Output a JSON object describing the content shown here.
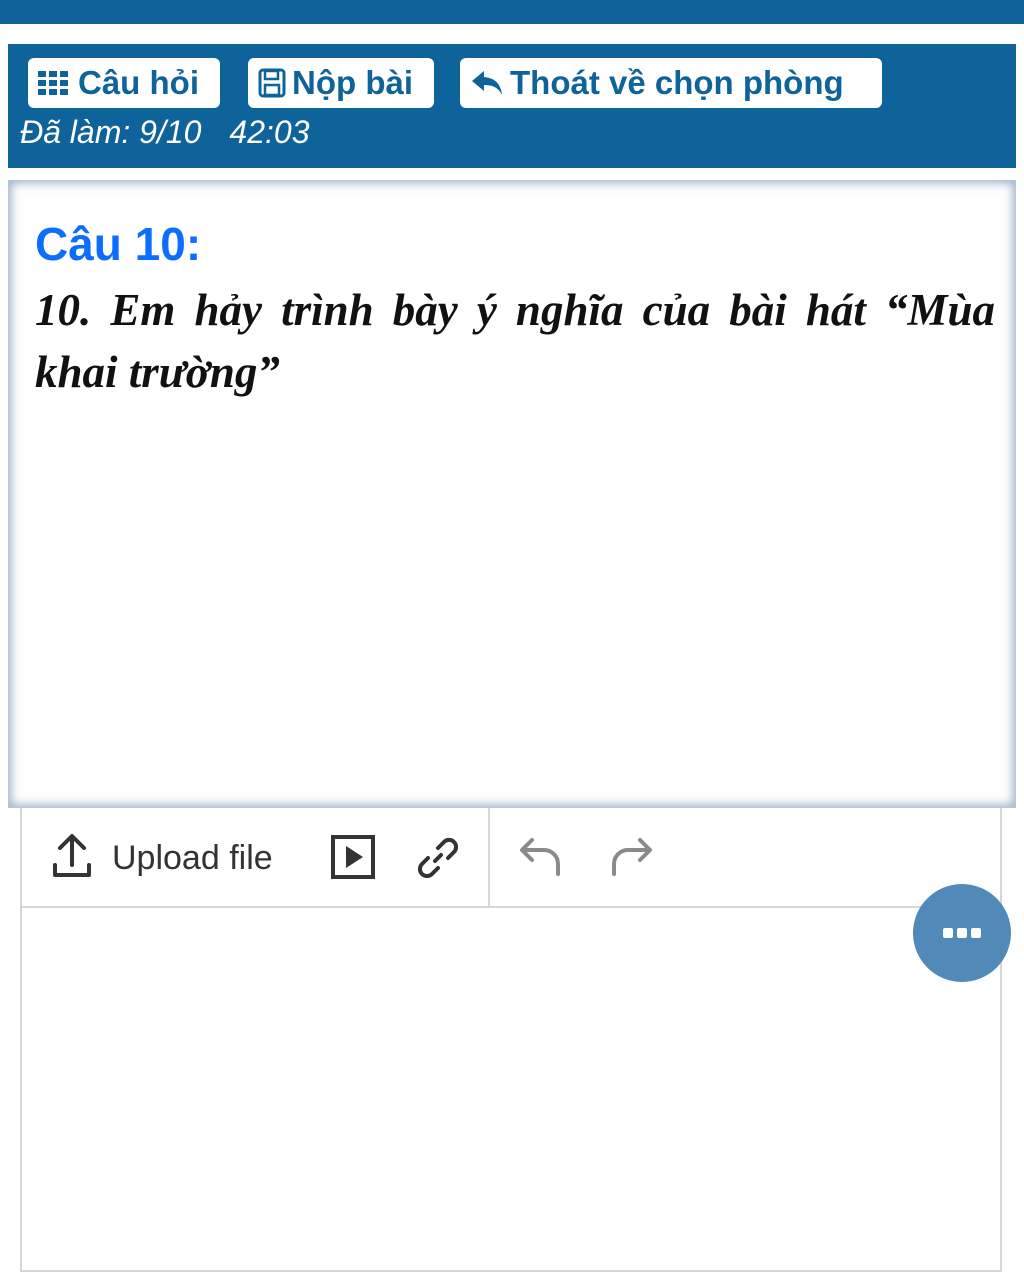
{
  "header": {
    "questions_label": "Câu hỏi",
    "submit_label": "Nộp bài",
    "exit_label": "Thoát về chọn phòng",
    "progress": "Đã làm: 9/10",
    "timer": "42:03"
  },
  "question": {
    "title": "Câu 10:",
    "text": "10. Em hảy trình bày ý nghĩa của bài hát “Mùa khai trường”"
  },
  "editor": {
    "upload_label": "Upload file",
    "icons": [
      "upload-icon",
      "media-icon",
      "link-icon",
      "undo-icon",
      "redo-icon"
    ],
    "content": ""
  },
  "fab": {
    "icon": "more-icon"
  },
  "colors": {
    "header_bg": "#0e639b",
    "title_blue": "#0d6efd",
    "fab_bg": "#5189b8"
  }
}
